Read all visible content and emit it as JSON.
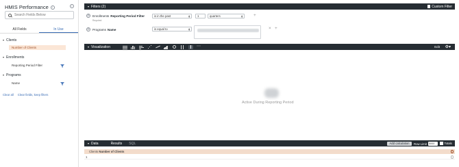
{
  "app_title": "HMIS Performance",
  "search": {
    "placeholder": "Search Fields Below"
  },
  "tabs": [
    {
      "label": "All Fields",
      "active": false
    },
    {
      "label": "In Use",
      "active": true
    }
  ],
  "views": [
    {
      "label": "Clients",
      "fields": [
        {
          "label": "Number of Clients",
          "selected": true,
          "has_filter": false
        }
      ]
    },
    {
      "label": "Enrollments",
      "fields": [
        {
          "label": "Reporting Period Filter",
          "selected": false,
          "has_filter": true
        }
      ]
    },
    {
      "label": "Programs",
      "fields": [
        {
          "label": "Name",
          "selected": false,
          "has_filter": true
        }
      ]
    }
  ],
  "left_links": {
    "clear_all": "Clear all",
    "clear_keep": "Clear fields, keep filters"
  },
  "filters": {
    "header": "Filters (2)",
    "custom_filter": "Custom Filter",
    "rows": [
      {
        "view": "Enrollments",
        "field": "Reporting Period Filter",
        "required": "Required",
        "operator": "is in the past",
        "value": "1",
        "unit": "quarters"
      },
      {
        "view": "Programs",
        "field": "Name",
        "operator": "is equal to"
      }
    ]
  },
  "visualization": {
    "header": "Visualization",
    "edit_label": "Edit",
    "caption": "Active During Reporting Period"
  },
  "data": {
    "header": "Data",
    "tabs": [
      {
        "label": "Results",
        "active": true
      },
      {
        "label": "SQL",
        "active": false
      }
    ],
    "add_calc": "Add calculation",
    "row_limit_label": "Row Limit",
    "row_limit_value": "5000",
    "totals_label": "Totals",
    "column_header_view": "Clients",
    "column_header_field": "Number of Clients",
    "row_index": "1"
  },
  "colors": {
    "dark_bar": "#262d33",
    "accent_blue": "#3a6db5",
    "selected_field_bg": "#fbe6d6",
    "data_header_bg": "#f3dccb"
  }
}
